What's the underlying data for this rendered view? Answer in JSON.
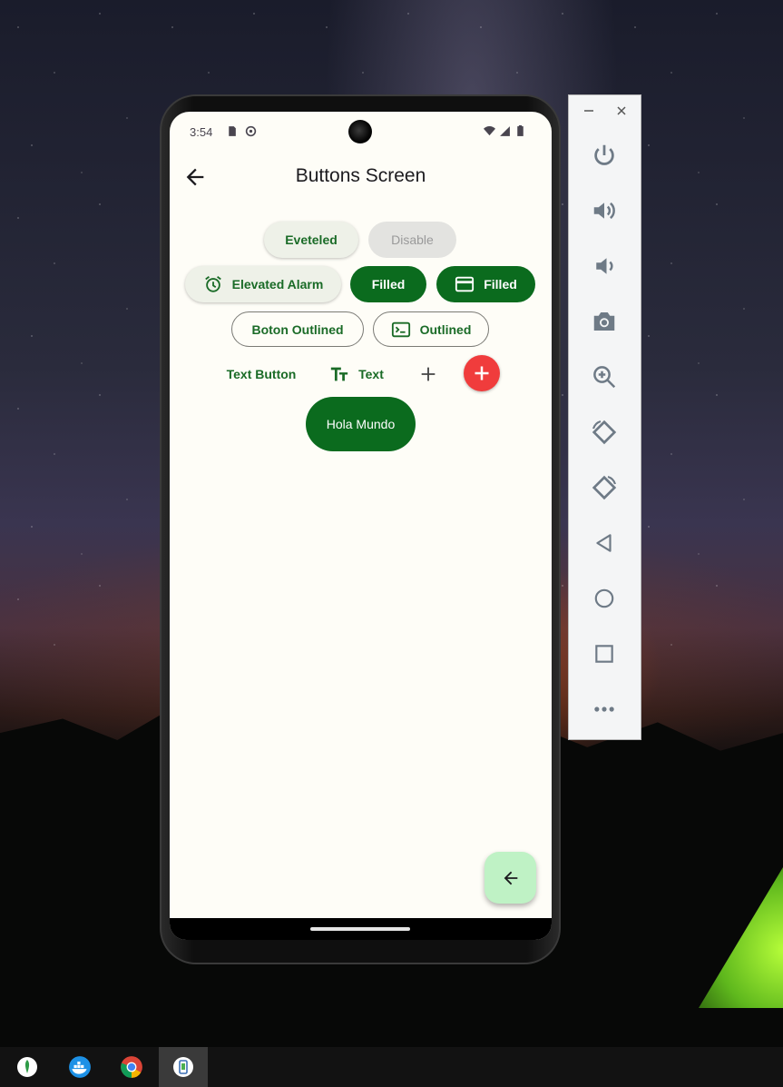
{
  "status_bar": {
    "time": "3:54"
  },
  "app_bar": {
    "title": "Buttons Screen"
  },
  "buttons": {
    "elevated": "Eveteled",
    "disabled": "Disable",
    "elevated_icon": "Elevated Alarm",
    "filled": "Filled",
    "filled_icon": "Filled",
    "outlined": "Boton Outlined",
    "outlined_icon": "Outlined",
    "text": "Text Button",
    "text_icon": "Text",
    "custom": "Hola Mundo"
  },
  "icons": {
    "back": "arrow-left-icon",
    "alarm": "alarm-icon",
    "card": "credit-card-icon",
    "terminal": "terminal-icon",
    "text_fields": "text-fields-icon",
    "add": "add-icon",
    "fab_add": "add-icon",
    "fab_back": "arrow-left-icon"
  },
  "emulator_toolbar": {
    "items": [
      "power",
      "volume-up",
      "volume-down",
      "camera",
      "zoom",
      "rotate-left",
      "rotate-right",
      "back",
      "home",
      "overview",
      "more"
    ]
  },
  "taskbar": {
    "apps": [
      "mongodb",
      "docker",
      "chrome",
      "android-studio"
    ]
  },
  "colors": {
    "primary": "#0b6b1e",
    "primary_container": "#bff2c5",
    "error_fab": "#f03c3c",
    "surface": "#fefdf7"
  }
}
